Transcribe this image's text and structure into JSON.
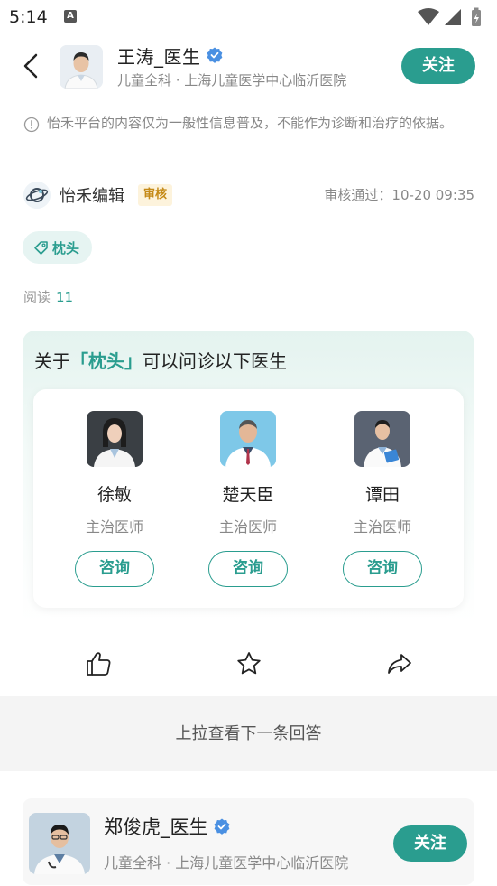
{
  "status_bar": {
    "time": "5:14",
    "notif_letter": "A"
  },
  "header": {
    "name": "王涛_医生",
    "subtitle": "儿童全科 · 上海儿童医学中心临沂医院",
    "follow_label": "关注"
  },
  "disclaimer": "怡禾平台的内容仅为一般性信息普及，不能作为诊断和治疗的依据。",
  "editor": {
    "name": "怡禾编辑",
    "badge": "审核",
    "review_time": "审核通过：10-20 09:35"
  },
  "tag": {
    "label": "枕头"
  },
  "reads": {
    "label": "阅读",
    "count": "11"
  },
  "doctors_panel": {
    "title_prefix": "关于",
    "title_tag": "「枕头」",
    "title_suffix": "可以问诊以下医生",
    "doctors": [
      {
        "name": "徐敏",
        "title": "主治医师",
        "consult_label": "咨询"
      },
      {
        "name": "楚天臣",
        "title": "主治医师",
        "consult_label": "咨询"
      },
      {
        "name": "谭田",
        "title": "主治医师",
        "consult_label": "咨询"
      }
    ]
  },
  "pullup_text": "上拉查看下一条回答",
  "next_answer": {
    "name": "郑俊虎_医生",
    "subtitle": "儿童全科 · 上海儿童医学中心临沂医院",
    "follow_label": "关注"
  },
  "colors": {
    "accent": "#2a9d8f",
    "badge_bg": "#fdf3dc",
    "badge_text": "#c58a17",
    "verified": "#4a90e2"
  }
}
